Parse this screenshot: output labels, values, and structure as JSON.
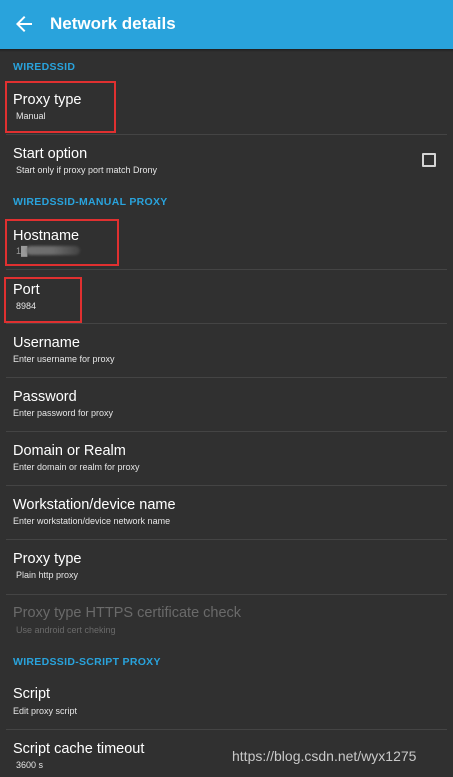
{
  "appbar": {
    "title": "Network details",
    "back_icon": "arrow-left-icon",
    "color": "#29a3dc"
  },
  "sections": {
    "wiredssid": "WIREDSSID",
    "manual_proxy": "WIREDSSID-MANUAL PROXY",
    "script_proxy": "WIREDSSID-SCRIPT PROXY"
  },
  "prefs": {
    "proxy_type": {
      "title": "Proxy type",
      "summary": "Manual"
    },
    "start_option": {
      "title": "Start option",
      "summary": "Start only if proxy port match Drony",
      "checked": false
    },
    "hostname": {
      "title": "Hostname",
      "summary": "1█"
    },
    "port": {
      "title": "Port",
      "summary": "8984"
    },
    "username": {
      "title": "Username",
      "summary": "Enter username for proxy"
    },
    "password": {
      "title": "Password",
      "summary": "Enter password for proxy"
    },
    "domain": {
      "title": "Domain or Realm",
      "summary": "Enter domain or realm for proxy"
    },
    "workstation": {
      "title": "Workstation/device name",
      "summary": "Enter workstation/device network name"
    },
    "proxy_type_2": {
      "title": "Proxy type",
      "summary": "Plain http proxy"
    },
    "https_check": {
      "title": "Proxy type HTTPS certificate check",
      "summary": "Use android cert cheking",
      "enabled": false
    },
    "script": {
      "title": "Script",
      "summary": "Edit proxy script"
    },
    "script_cache": {
      "title": "Script cache timeout",
      "summary": "3600 s"
    }
  },
  "watermark": "https://blog.csdn.net/wyx1275",
  "colors": {
    "background": "#303030",
    "accent": "#29a3dc",
    "annotation": "#e03030"
  }
}
